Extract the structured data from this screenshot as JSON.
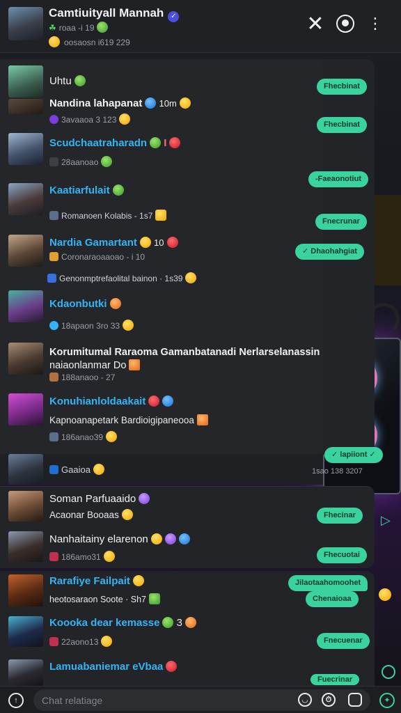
{
  "header": {
    "title": "Camtiuityall Mannah",
    "presence": "roaa -i 19",
    "presence_lead": "☘",
    "members": "oosaosn i619 229"
  },
  "rows_top": [
    {
      "name": "Uhtu",
      "meta": "",
      "name_color": "white"
    },
    {
      "name": "Nandina lahapanat",
      "meta": "3avaaoa 3 123",
      "suffix": "10m",
      "name_color": "white"
    },
    {
      "name": "Scudchaatraharadn",
      "meta": "28aanoao",
      "suffix": "I",
      "name_color": "blue"
    },
    {
      "name": "Kaatiarfulait",
      "meta": "",
      "msg": "Romanoen Kolabis - 1s7",
      "name_color": "blue"
    },
    {
      "name": "Nardia Gamartant",
      "meta": "Coronaraoaaoao - i 10",
      "suffix": "10",
      "msg": "Genonmptrefaolital bainon · 1s39",
      "name_color": "blue"
    },
    {
      "name": "Kdaonbutki",
      "meta": "18apaon 3ro 33",
      "name_color": "blue"
    },
    {
      "name": "Korumitumal Raraoma Gamanbatanadi Nerlarselanassin",
      "name2": "naiaonlanmar Do",
      "meta": "188anaoo - 27",
      "name_color": "white"
    },
    {
      "name": "Konuhianloldaakait",
      "msg": "Kapnoanapetark Bardioigipaneooa",
      "meta": "186anao39",
      "name_color": "blue"
    },
    {
      "name": "",
      "meta": "Gaaioa",
      "name_color": "white"
    }
  ],
  "rows_mid": [
    {
      "name": "Soman Parfuaaido",
      "meta": "Acaonar Booaas",
      "name_color": "white"
    },
    {
      "name": "Nanhaitainy elarenon",
      "meta": "186amo31",
      "name_color": "white"
    }
  ],
  "rows_bottom": [
    {
      "name": "Rarafiye Failpait",
      "meta": "heotosaraon Soote · Sh7",
      "name_color": "blue"
    },
    {
      "name": "Koooka dear kemasse",
      "meta": "22aono13",
      "suffix": "3",
      "name_color": "blue"
    },
    {
      "name": "Lamuabaniemar eVbaa",
      "meta": "",
      "name_color": "blue"
    }
  ],
  "bubbles": [
    "Fhecbinat",
    "Fhecbinat",
    "-Faeaonotiut",
    "Fnecrunar",
    "✓ Dhaohahgiat",
    "✓ lapiiont ✓",
    "Fhecinar",
    "Fhecuotai",
    "Jilaotaahomoohet",
    "Chenaioaa",
    "Fnecuenar",
    "Fuecrinar"
  ],
  "timestamp": "1sao 138 3207",
  "input": {
    "placeholder": "Chat relatiage"
  },
  "colors": {
    "accent": "#3ad29f",
    "name_blue": "#33b5f5",
    "panel": "#222427"
  }
}
